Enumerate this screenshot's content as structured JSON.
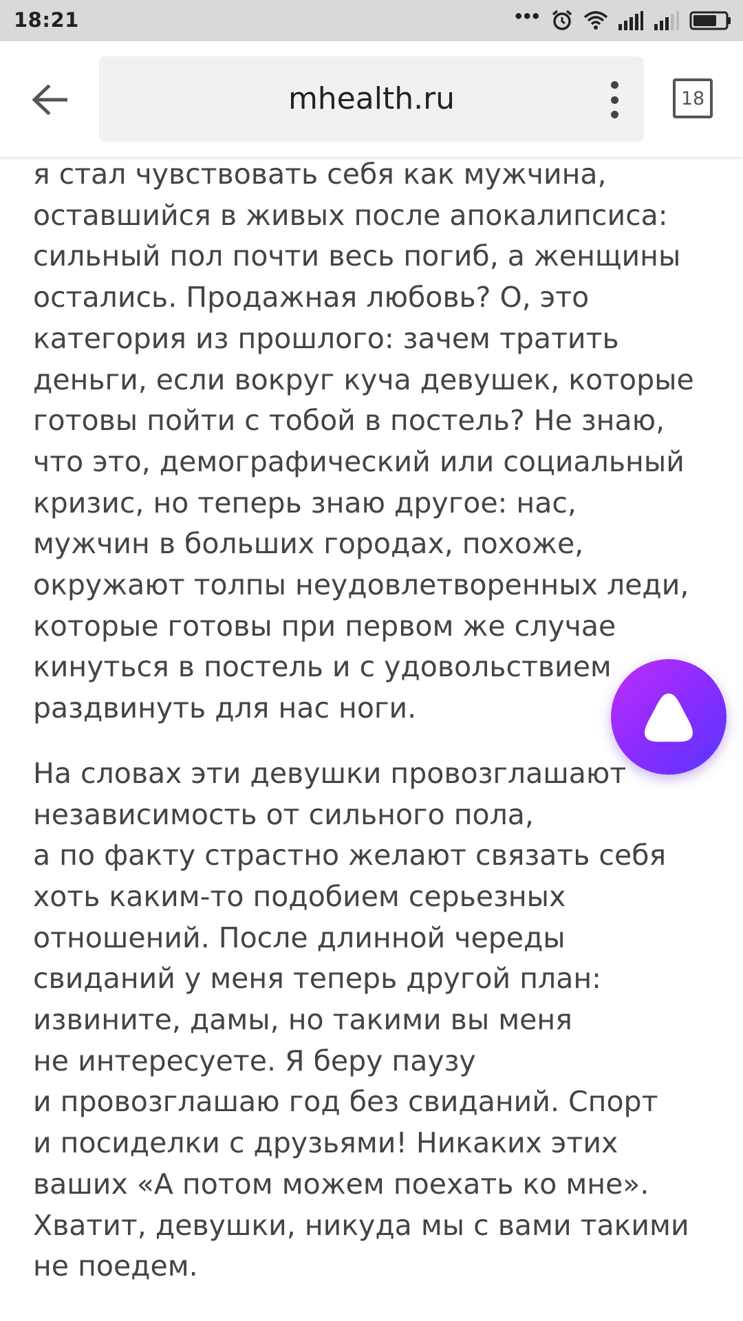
{
  "status_bar": {
    "time": "18:21",
    "icons": [
      "more-dots-icon",
      "alarm-icon",
      "wifi-icon",
      "signal-icon",
      "signal-icon",
      "battery-icon"
    ]
  },
  "toolbar": {
    "url": "mhealth.ru",
    "tab_count": "18"
  },
  "article": {
    "paragraphs": [
      [
        "я стал чувствовать себя как мужчина,",
        "оставшийся в живых после апокалипсиса:",
        "сильный пол почти весь погиб, а женщины",
        "остались. Продажная любовь? О, это",
        "категория из прошлого: зачем тратить",
        "деньги, если вокруг куча девушек, которые",
        "готовы пойти с тобой в постель? Не знаю,",
        "что это, демографический или социальный",
        "кризис, но теперь знаю другое: нас,",
        "мужчин в больших городах, похоже,",
        "окружают толпы неудовлетворенных леди,",
        "которые готовы при первом же случае",
        "кинуться в постель и с удовольствием",
        "раздвинуть для нас ноги."
      ],
      [
        "На словах эти девушки провозглашают",
        "независимость от сильного пола,",
        "а по факту страстно желают связать себя",
        "хоть каким-то подобием серьезных",
        "отношений. После длинной череды",
        "свиданий у меня теперь другой план:",
        "извините, дамы, но такими вы меня",
        "не интересуете. Я беру паузу",
        "и провозглашаю год без свиданий. Спорт",
        "и посиделки с друзьями! Никаких этих",
        "ваших «А потом можем поехать ко мне».",
        "Хватит, девушки, никуда мы с вами такими",
        "не поедем."
      ]
    ]
  },
  "alice_button": {
    "icon": "alice-assistant-icon"
  }
}
